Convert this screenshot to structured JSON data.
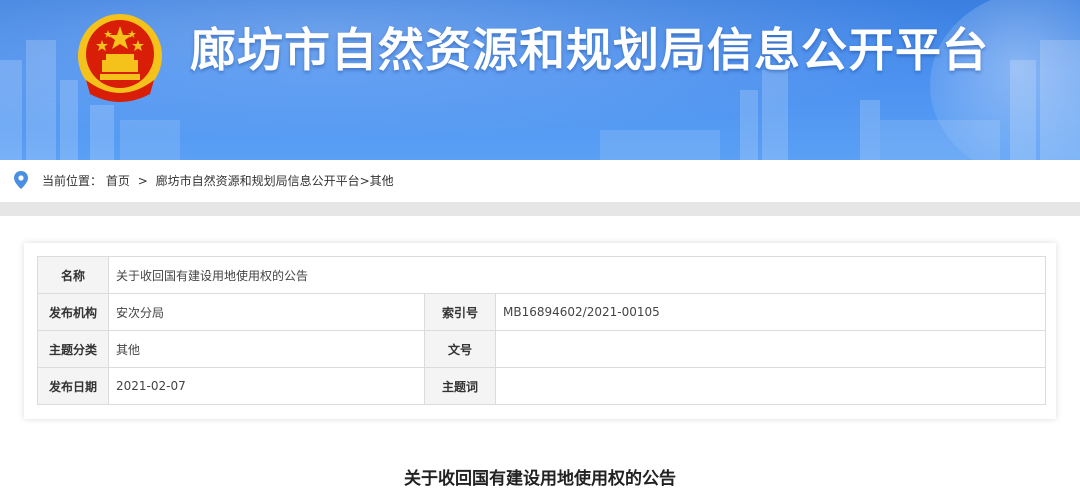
{
  "header": {
    "site_title": "廊坊市自然资源和规划局信息公开平台",
    "emblem": "national-emblem-icon"
  },
  "breadcrumb": {
    "icon": "location-pin-icon",
    "prefix": "当前位置：",
    "home": "首页",
    "separator": ">",
    "section": "廊坊市自然资源和规划局信息公开平台",
    "section_sep": ">",
    "current": "其他"
  },
  "info_table": {
    "name_label": "名称",
    "name_value": "关于收回国有建设用地使用权的公告",
    "publisher_label": "发布机构",
    "publisher_value": "安次分局",
    "index_label": "索引号",
    "index_value": "MB16894602/2021-00105",
    "category_label": "主题分类",
    "category_value": "其他",
    "docno_label": "文号",
    "docno_value": "",
    "date_label": "发布日期",
    "date_value": "2021-02-07",
    "keywords_label": "主题词",
    "keywords_value": ""
  },
  "article": {
    "title": "关于收回国有建设用地使用权的公告"
  },
  "colors": {
    "banner_blue": "#3a7fe0",
    "pin_blue": "#4a90e2",
    "emblem_red": "#d81e06",
    "emblem_gold": "#f5c21b"
  }
}
